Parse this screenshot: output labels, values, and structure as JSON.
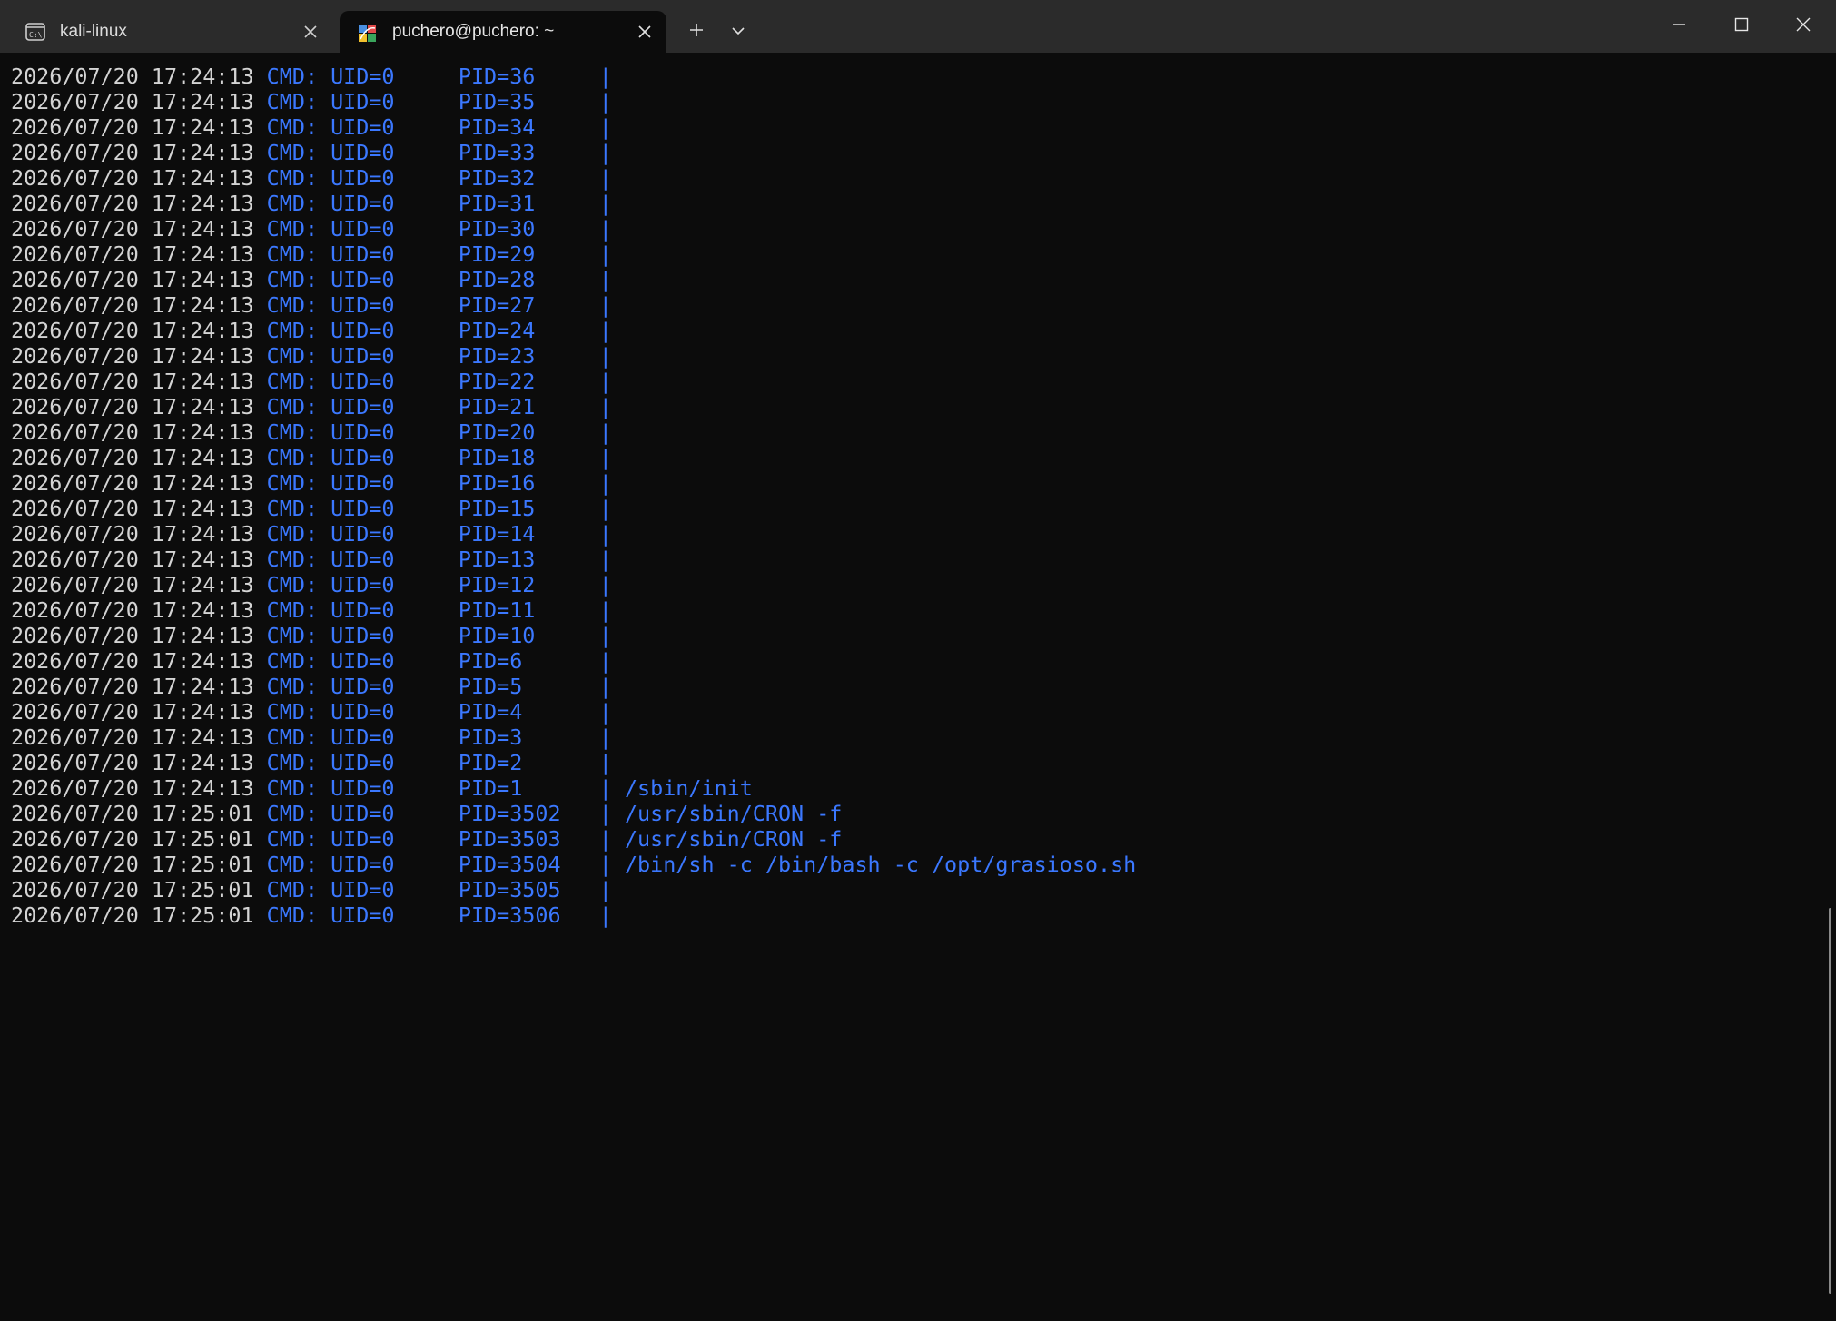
{
  "tabs": [
    {
      "label": "kali-linux",
      "icon": "cmd-prompt-icon",
      "active": false
    },
    {
      "label": "puchero@puchero: ~",
      "icon": "kali-linux-icon",
      "active": true
    }
  ],
  "toolbar": {
    "new_tab_icon": "plus-icon",
    "dropdown_icon": "chevron-down-icon"
  },
  "window_controls": [
    "minimize-icon",
    "maximize-icon",
    "close-icon"
  ],
  "colors": {
    "background": "#0c0c0c",
    "titlebar": "#2b2b2b",
    "timestamp_text": "#d4d4d4",
    "command_text": "#3b78ff"
  },
  "terminal": {
    "lines": [
      {
        "ts": "2026/07/20 17:24:13",
        "rest": " CMD: UID=0     PID=36     | "
      },
      {
        "ts": "2026/07/20 17:24:13",
        "rest": " CMD: UID=0     PID=35     | "
      },
      {
        "ts": "2026/07/20 17:24:13",
        "rest": " CMD: UID=0     PID=34     | "
      },
      {
        "ts": "2026/07/20 17:24:13",
        "rest": " CMD: UID=0     PID=33     | "
      },
      {
        "ts": "2026/07/20 17:24:13",
        "rest": " CMD: UID=0     PID=32     | "
      },
      {
        "ts": "2026/07/20 17:24:13",
        "rest": " CMD: UID=0     PID=31     | "
      },
      {
        "ts": "2026/07/20 17:24:13",
        "rest": " CMD: UID=0     PID=30     | "
      },
      {
        "ts": "2026/07/20 17:24:13",
        "rest": " CMD: UID=0     PID=29     | "
      },
      {
        "ts": "2026/07/20 17:24:13",
        "rest": " CMD: UID=0     PID=28     | "
      },
      {
        "ts": "2026/07/20 17:24:13",
        "rest": " CMD: UID=0     PID=27     | "
      },
      {
        "ts": "2026/07/20 17:24:13",
        "rest": " CMD: UID=0     PID=24     | "
      },
      {
        "ts": "2026/07/20 17:24:13",
        "rest": " CMD: UID=0     PID=23     | "
      },
      {
        "ts": "2026/07/20 17:24:13",
        "rest": " CMD: UID=0     PID=22     | "
      },
      {
        "ts": "2026/07/20 17:24:13",
        "rest": " CMD: UID=0     PID=21     | "
      },
      {
        "ts": "2026/07/20 17:24:13",
        "rest": " CMD: UID=0     PID=20     | "
      },
      {
        "ts": "2026/07/20 17:24:13",
        "rest": " CMD: UID=0     PID=18     | "
      },
      {
        "ts": "2026/07/20 17:24:13",
        "rest": " CMD: UID=0     PID=16     | "
      },
      {
        "ts": "2026/07/20 17:24:13",
        "rest": " CMD: UID=0     PID=15     | "
      },
      {
        "ts": "2026/07/20 17:24:13",
        "rest": " CMD: UID=0     PID=14     | "
      },
      {
        "ts": "2026/07/20 17:24:13",
        "rest": " CMD: UID=0     PID=13     | "
      },
      {
        "ts": "2026/07/20 17:24:13",
        "rest": " CMD: UID=0     PID=12     | "
      },
      {
        "ts": "2026/07/20 17:24:13",
        "rest": " CMD: UID=0     PID=11     | "
      },
      {
        "ts": "2026/07/20 17:24:13",
        "rest": " CMD: UID=0     PID=10     | "
      },
      {
        "ts": "2026/07/20 17:24:13",
        "rest": " CMD: UID=0     PID=6      | "
      },
      {
        "ts": "2026/07/20 17:24:13",
        "rest": " CMD: UID=0     PID=5      | "
      },
      {
        "ts": "2026/07/20 17:24:13",
        "rest": " CMD: UID=0     PID=4      | "
      },
      {
        "ts": "2026/07/20 17:24:13",
        "rest": " CMD: UID=0     PID=3      | "
      },
      {
        "ts": "2026/07/20 17:24:13",
        "rest": " CMD: UID=0     PID=2      | "
      },
      {
        "ts": "2026/07/20 17:24:13",
        "rest": " CMD: UID=0     PID=1      | /sbin/init"
      },
      {
        "ts": "2026/07/20 17:25:01",
        "rest": " CMD: UID=0     PID=3502   | /usr/sbin/CRON -f"
      },
      {
        "ts": "2026/07/20 17:25:01",
        "rest": " CMD: UID=0     PID=3503   | /usr/sbin/CRON -f"
      },
      {
        "ts": "2026/07/20 17:25:01",
        "rest": " CMD: UID=0     PID=3504   | /bin/sh -c /bin/bash -c /opt/grasioso.sh"
      },
      {
        "ts": "2026/07/20 17:25:01",
        "rest": " CMD: UID=0     PID=3505   | "
      },
      {
        "ts": "2026/07/20 17:25:01",
        "rest": " CMD: UID=0     PID=3506   | "
      }
    ]
  }
}
